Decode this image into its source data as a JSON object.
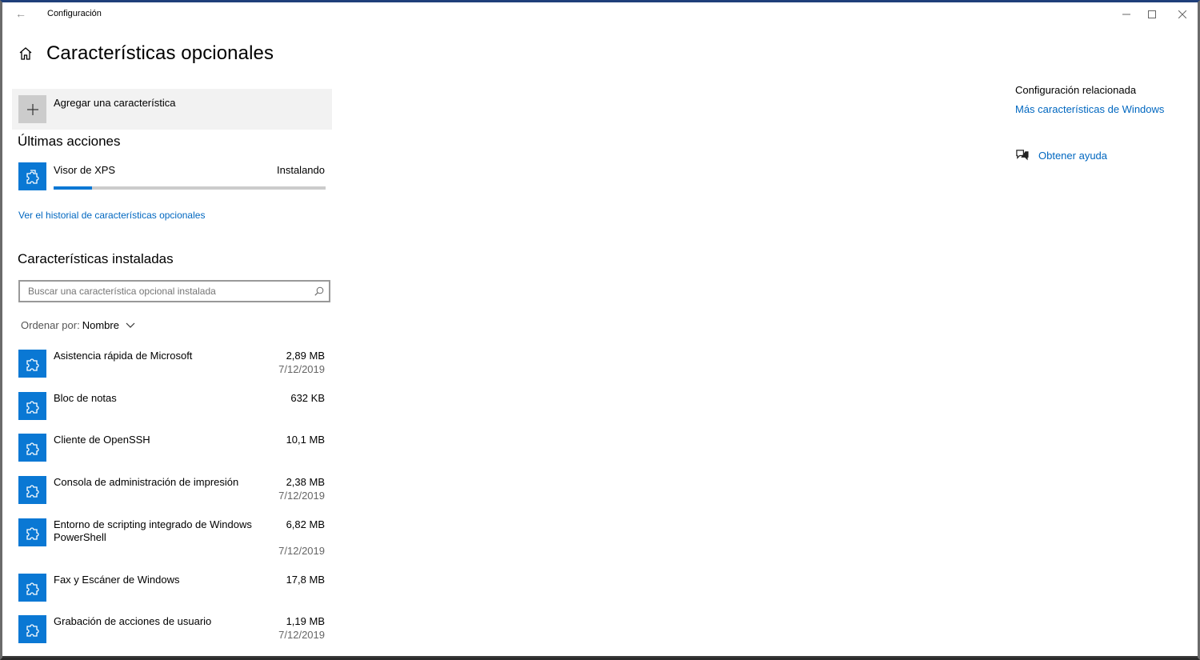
{
  "window": {
    "title": "Configuración"
  },
  "page": {
    "title": "Características opcionales"
  },
  "add_feature": {
    "label": "Agregar una característica"
  },
  "recent": {
    "title": "Últimas acciones",
    "items": [
      {
        "name": "Visor de XPS",
        "status": "Instalando",
        "progress": 0.14
      }
    ],
    "history_link": "Ver el historial de características opcionales"
  },
  "installed": {
    "title": "Características instaladas",
    "search_placeholder": "Buscar una característica opcional instalada",
    "sort_label": "Ordenar por:",
    "sort_value": "Nombre",
    "items": [
      {
        "name": "Asistencia rápida de Microsoft",
        "size": "2,89 MB",
        "date": "7/12/2019"
      },
      {
        "name": "Bloc de notas",
        "size": "632 KB",
        "date": ""
      },
      {
        "name": "Cliente de OpenSSH",
        "size": "10,1 MB",
        "date": ""
      },
      {
        "name": "Consola de administración de impresión",
        "size": "2,38 MB",
        "date": "7/12/2019"
      },
      {
        "name": "Entorno de scripting integrado de Windows PowerShell",
        "size": "6,82 MB",
        "date": "7/12/2019"
      },
      {
        "name": "Fax y Escáner de Windows",
        "size": "17,8 MB",
        "date": ""
      },
      {
        "name": "Grabación de acciones de usuario",
        "size": "1,19 MB",
        "date": "7/12/2019"
      }
    ]
  },
  "related": {
    "title": "Configuración relacionada",
    "link": "Más características de Windows",
    "help": "Obtener ayuda"
  },
  "colors": {
    "accent": "#0a78d4",
    "link": "#0067c0"
  },
  "icons": {
    "home": "home-icon",
    "plus": "plus-icon",
    "puzzle": "puzzle-icon",
    "search": "search-icon",
    "help": "help-icon"
  }
}
